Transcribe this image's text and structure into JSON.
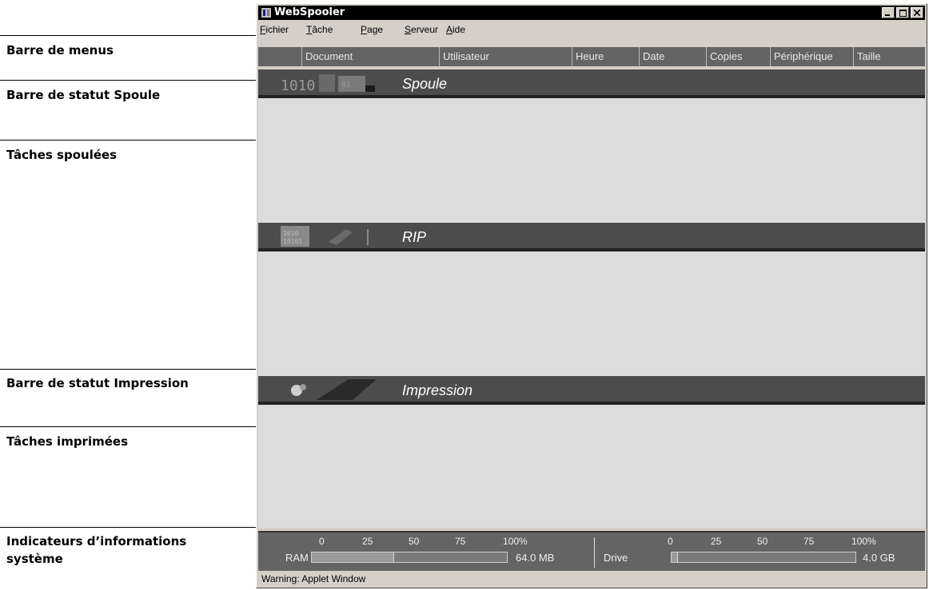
{
  "annotations": [
    {
      "label": "Barre de menus"
    },
    {
      "label": "Barre de statut Spoule"
    },
    {
      "label": "Tâches spoulées"
    },
    {
      "label": "Barre de statut Impression"
    },
    {
      "label": "Tâches imprimées"
    },
    {
      "label": "Indicateurs d’informations système"
    }
  ],
  "window": {
    "title": "WebSpooler",
    "menu": [
      {
        "u": "F",
        "rest": "ichier"
      },
      {
        "u": "T",
        "rest": "âche"
      },
      {
        "u": "P",
        "rest": "age"
      },
      {
        "u": "S",
        "rest": "erveur"
      },
      {
        "u": "A",
        "rest": "ide"
      }
    ],
    "columns": [
      "Document",
      "Utilisateur",
      "Heure",
      "Date",
      "Copies",
      "Périphérique",
      "Taille"
    ],
    "status_bars": {
      "spool": "Spoule",
      "rip": "RIP",
      "print": "Impression"
    },
    "info": {
      "ticks": [
        "0",
        "25",
        "50",
        "75",
        "100%"
      ],
      "ram": {
        "label": "RAM",
        "capacity": "64.0 MB",
        "fill_fraction": 0.42
      },
      "drive": {
        "label": "Drive",
        "capacity": "4.0 GB",
        "fill_fraction": 0.03
      }
    },
    "warning": "Warning: Applet Window"
  }
}
